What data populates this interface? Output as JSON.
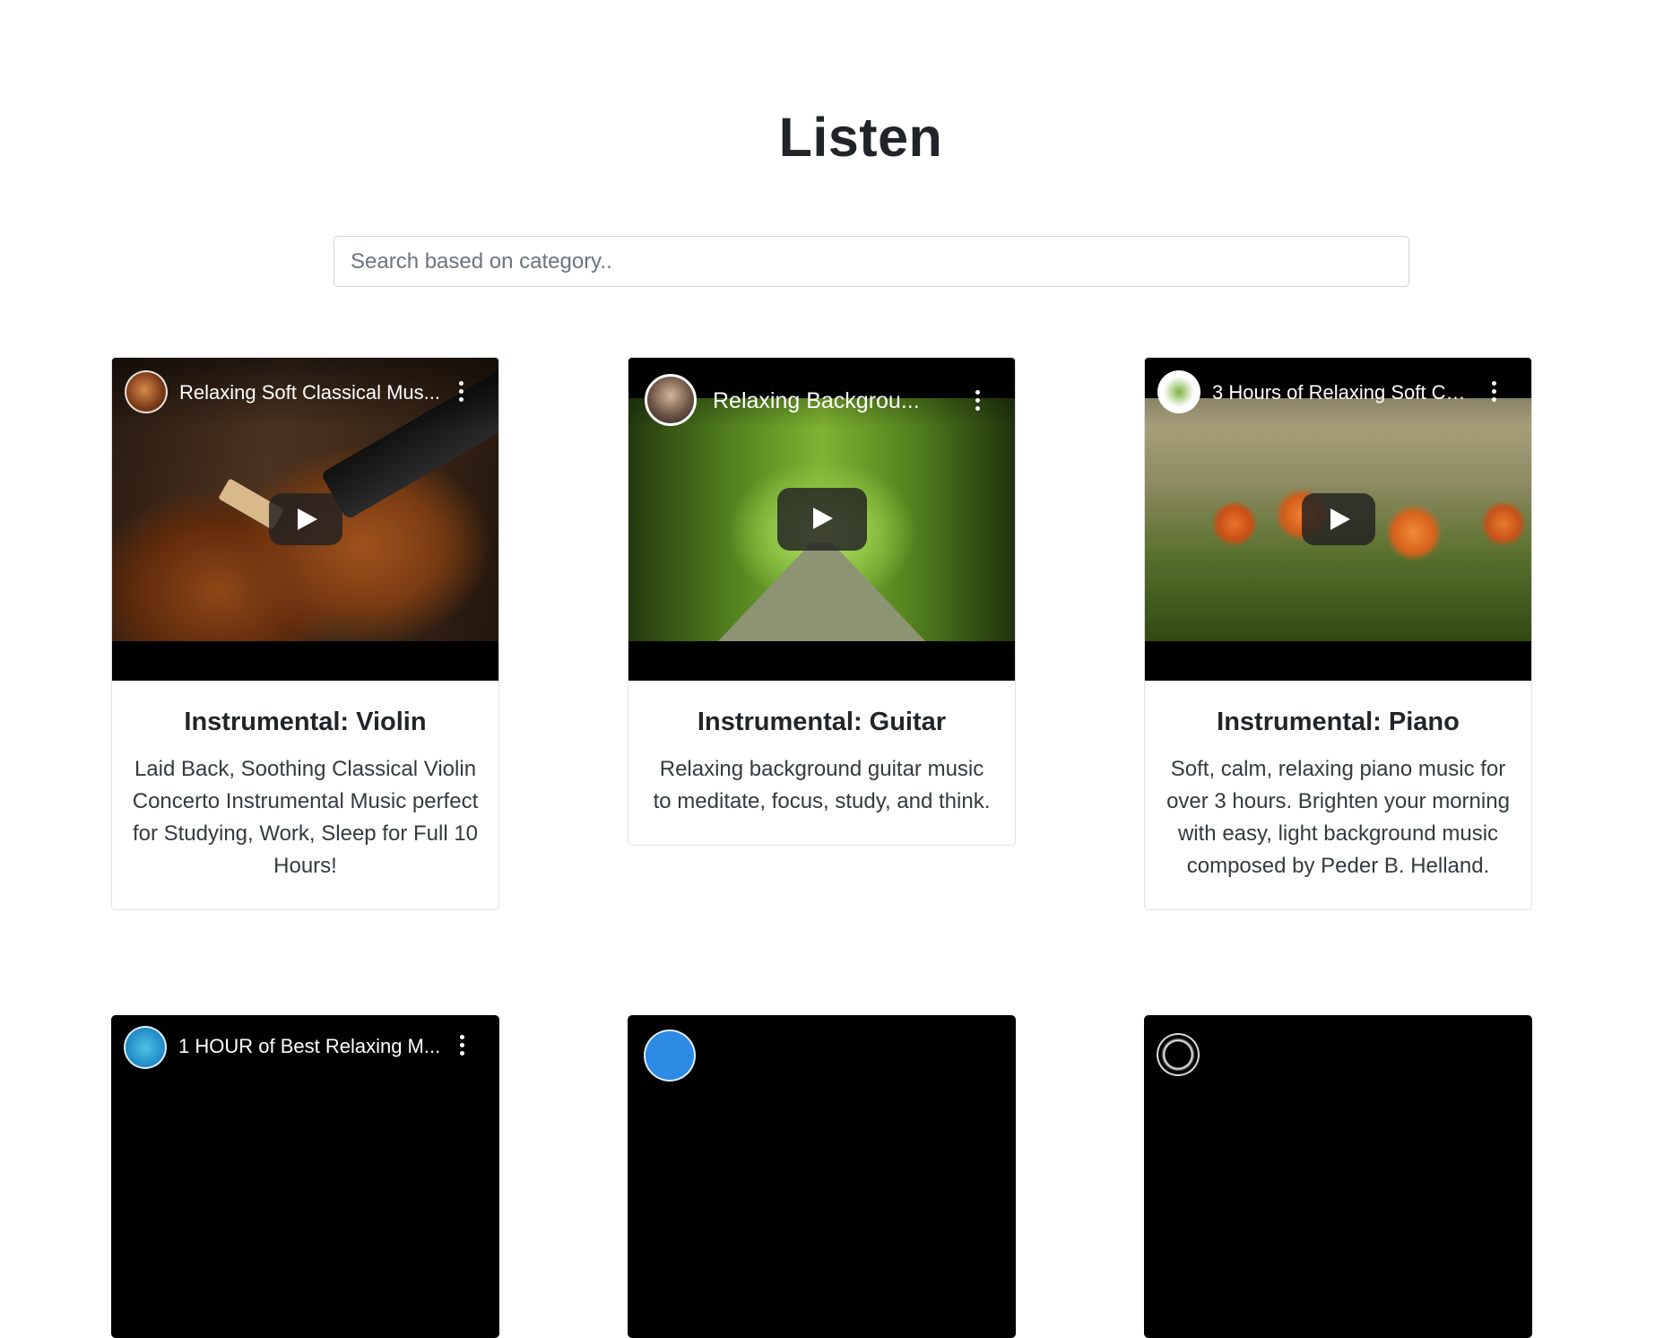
{
  "page": {
    "title": "Listen"
  },
  "search": {
    "placeholder": "Search based on category.."
  },
  "cards": [
    {
      "video_title": "Relaxing Soft Classical Mus...",
      "title": "Instrumental: Violin",
      "description": "Laid Back, Soothing Classical Violin Concerto Instrumental Music perfect for Studying, Work, Sleep for Full 10 Hours!"
    },
    {
      "video_title": "Relaxing Backgrou...",
      "title": "Instrumental: Guitar",
      "description": "Relaxing background guitar music to meditate, focus, study, and think."
    },
    {
      "video_title": "3 Hours of Relaxing Soft Cal...",
      "title": "Instrumental: Piano",
      "description": "Soft, calm, relaxing piano music for over 3 hours. Brighten your morning with easy, light background music composed by Peder B. Helland."
    },
    {
      "video_title": "1 HOUR of Best Relaxing M..."
    },
    {
      "video_title": ""
    },
    {
      "video_title": ""
    }
  ],
  "icons": {
    "play": "play-icon",
    "more": "more-vertical-icon"
  }
}
